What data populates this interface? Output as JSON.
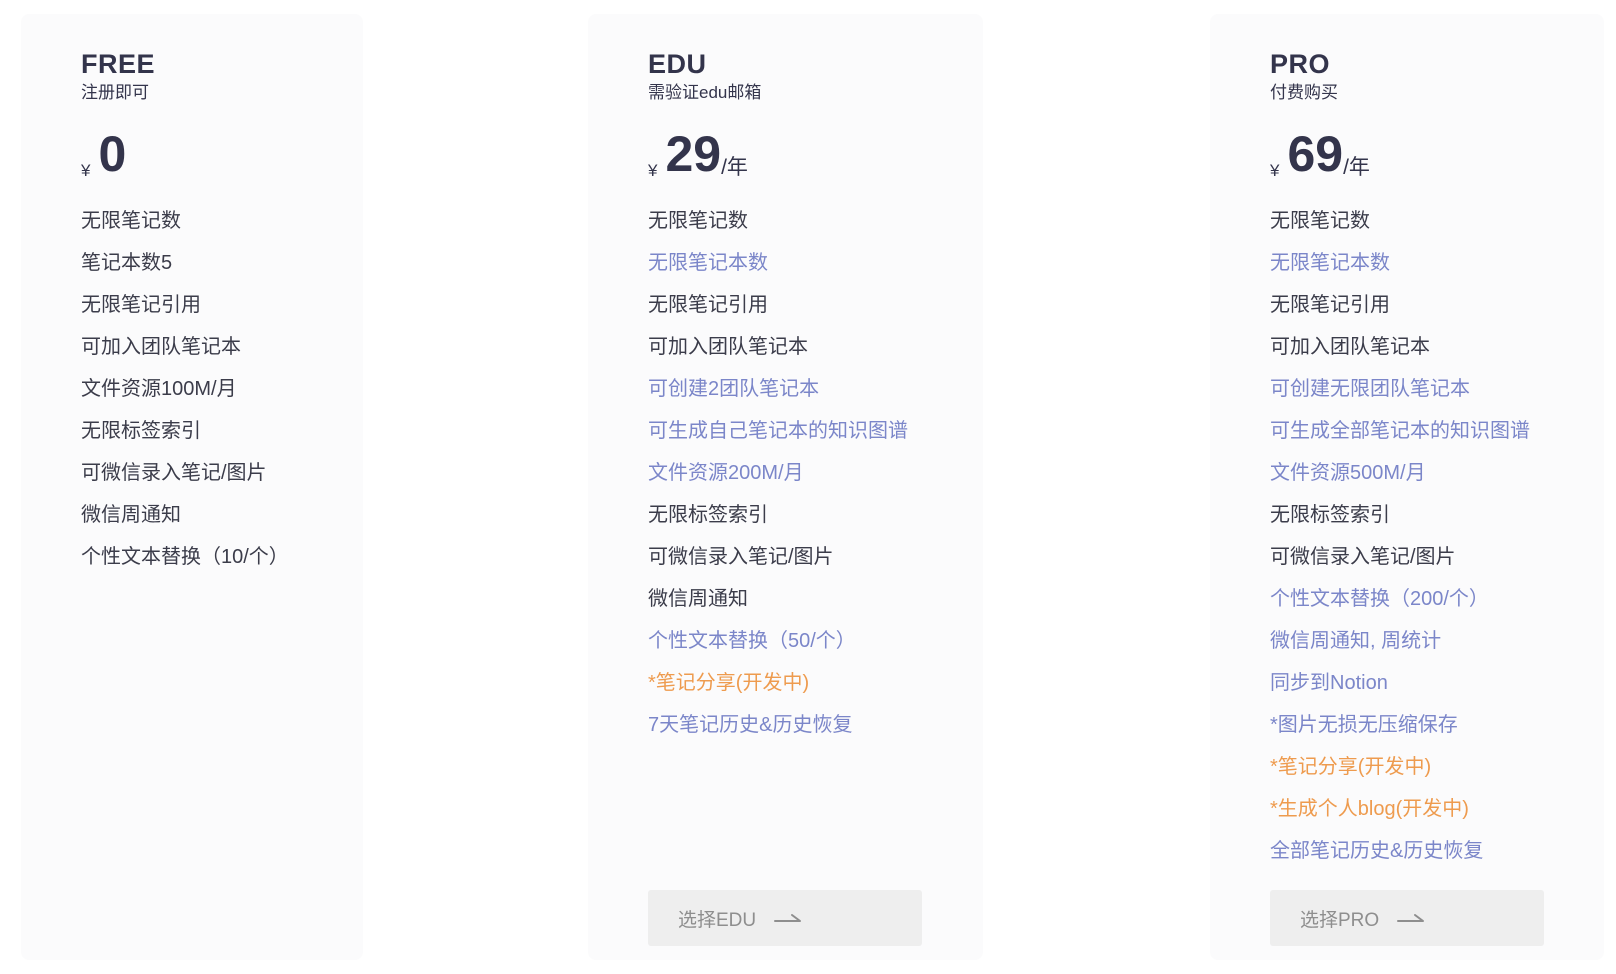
{
  "plans": {
    "free": {
      "name": "FREE",
      "subtitle": "注册即可",
      "currency": "¥",
      "price": "0",
      "period": "",
      "features": [
        {
          "text": "无限笔记数",
          "style": "normal"
        },
        {
          "text": "笔记本数5",
          "style": "normal"
        },
        {
          "text": "无限笔记引用",
          "style": "normal"
        },
        {
          "text": "可加入团队笔记本",
          "style": "normal"
        },
        {
          "text": "文件资源100M/月",
          "style": "normal"
        },
        {
          "text": "无限标签索引",
          "style": "normal"
        },
        {
          "text": "可微信录入笔记/图片",
          "style": "normal"
        },
        {
          "text": "微信周通知",
          "style": "normal"
        },
        {
          "text": "个性文本替换（10/个）",
          "style": "normal"
        }
      ]
    },
    "edu": {
      "name": "EDU",
      "subtitle": "需验证edu邮箱",
      "currency": "¥",
      "price": "29",
      "period": "/年",
      "features": [
        {
          "text": "无限笔记数",
          "style": "normal"
        },
        {
          "text": "无限笔记本数",
          "style": "highlight"
        },
        {
          "text": "无限笔记引用",
          "style": "normal"
        },
        {
          "text": "可加入团队笔记本",
          "style": "normal"
        },
        {
          "text": "可创建2团队笔记本",
          "style": "highlight"
        },
        {
          "text": "可生成自己笔记本的知识图谱",
          "style": "highlight"
        },
        {
          "text": "文件资源200M/月",
          "style": "highlight"
        },
        {
          "text": "无限标签索引",
          "style": "normal"
        },
        {
          "text": "可微信录入笔记/图片",
          "style": "normal"
        },
        {
          "text": "微信周通知",
          "style": "normal"
        },
        {
          "text": "个性文本替换（50/个）",
          "style": "highlight"
        },
        {
          "text": "*笔记分享(开发中)",
          "style": "dev"
        },
        {
          "text": "7天笔记历史&历史恢复",
          "style": "highlight"
        }
      ],
      "button_label": "选择EDU"
    },
    "pro": {
      "name": "PRO",
      "subtitle": "付费购买",
      "currency": "¥",
      "price": "69",
      "period": "/年",
      "features": [
        {
          "text": "无限笔记数",
          "style": "normal"
        },
        {
          "text": "无限笔记本数",
          "style": "highlight"
        },
        {
          "text": "无限笔记引用",
          "style": "normal"
        },
        {
          "text": "可加入团队笔记本",
          "style": "normal"
        },
        {
          "text": "可创建无限团队笔记本",
          "style": "highlight"
        },
        {
          "text": "可生成全部笔记本的知识图谱",
          "style": "highlight"
        },
        {
          "text": "文件资源500M/月",
          "style": "highlight"
        },
        {
          "text": "无限标签索引",
          "style": "normal"
        },
        {
          "text": "可微信录入笔记/图片",
          "style": "normal"
        },
        {
          "text": "个性文本替换（200/个）",
          "style": "highlight"
        },
        {
          "text": "微信周通知, 周统计",
          "style": "highlight"
        },
        {
          "text": "同步到Notion",
          "style": "highlight"
        },
        {
          "text": "*图片无损无压缩保存",
          "style": "highlight"
        },
        {
          "text": "*笔记分享(开发中)",
          "style": "dev"
        },
        {
          "text": "*生成个人blog(开发中)",
          "style": "dev"
        },
        {
          "text": "全部笔记历史&历史恢复",
          "style": "highlight"
        }
      ],
      "button_label": "选择PRO"
    }
  },
  "colors": {
    "normal": "#3b3c4a",
    "highlight": "#7b86c9",
    "dev": "#ee9b4e",
    "heading": "#33344b",
    "button_bg": "#eeeeee",
    "button_text": "#8e8e8e"
  },
  "icons": {
    "button_arrow": "long-right-arrow-icon"
  }
}
